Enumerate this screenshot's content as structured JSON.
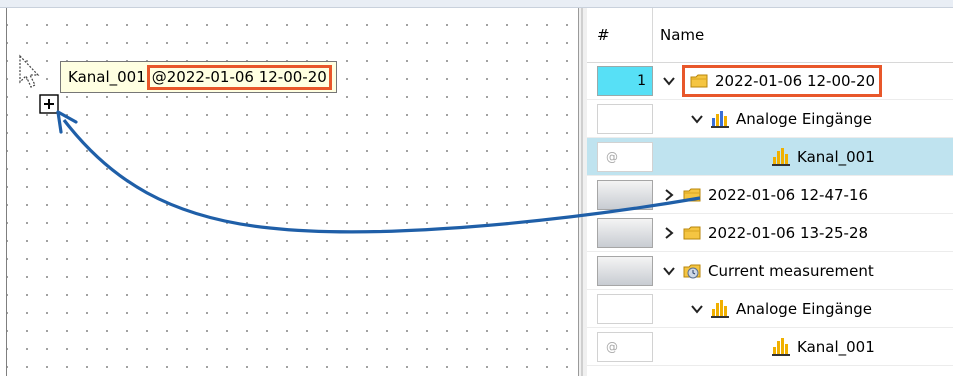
{
  "tooltip": {
    "channel": "Kanal_001",
    "at_time": "@2022-01-06 12-00-20"
  },
  "header": {
    "num_label": "#",
    "name_label": "Name"
  },
  "rows": [
    {
      "num": "1",
      "label": "2022-01-06 12-00-20",
      "icon": "folder-icon",
      "expand": "expanded"
    },
    {
      "num": "",
      "label": "Analoge Eingänge",
      "icon": "channel-group-lock-icon",
      "expand": "expanded"
    },
    {
      "num": "@",
      "label": "Kanal_001",
      "icon": "channel-icon",
      "expand": "none"
    },
    {
      "num": "",
      "label": "2022-01-06 12-47-16",
      "icon": "folder-icon",
      "expand": "collapsed"
    },
    {
      "num": "",
      "label": "2022-01-06 13-25-28",
      "icon": "folder-icon",
      "expand": "collapsed"
    },
    {
      "num": "",
      "label": "Current measurement",
      "icon": "current-measurement-icon",
      "expand": "expanded"
    },
    {
      "num": "",
      "label": "Analoge Eingänge",
      "icon": "channel-group-icon",
      "expand": "expanded"
    },
    {
      "num": "@",
      "label": "Kanal_001",
      "icon": "channel-icon",
      "expand": "none"
    }
  ],
  "colors": {
    "highlight_outline": "#e8572a",
    "drag_arrow": "#1f5fa8",
    "selected_num": "#57e0f6",
    "row_highlight": "#bfe3ef",
    "tooltip_bg": "#ffffe1"
  }
}
